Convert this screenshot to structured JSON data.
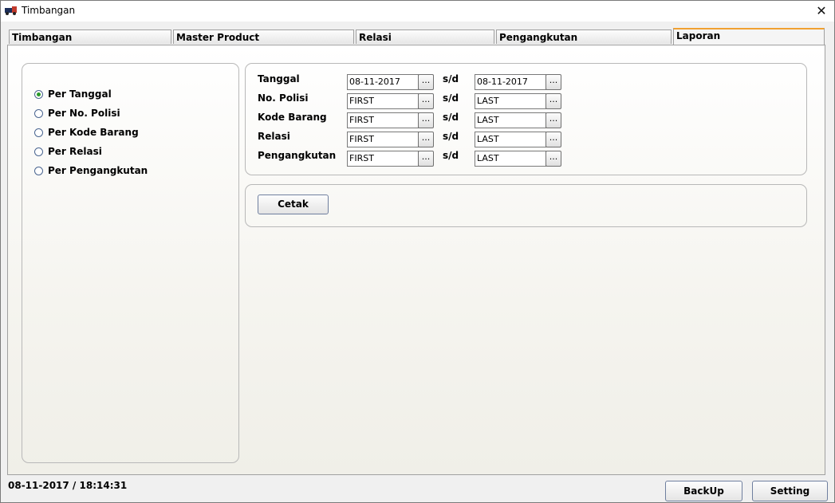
{
  "window": {
    "title": "Timbangan",
    "close_glyph": "✕"
  },
  "tabs": [
    {
      "label": "Timbangan"
    },
    {
      "label": "Master Product"
    },
    {
      "label": "Relasi"
    },
    {
      "label": "Pengangkutan"
    },
    {
      "label": "Laporan",
      "active": true
    }
  ],
  "report_options": [
    {
      "label": "Per Tanggal",
      "checked": true
    },
    {
      "label": "Per No. Polisi",
      "checked": false
    },
    {
      "label": "Per Kode Barang",
      "checked": false
    },
    {
      "label": "Per Relasi",
      "checked": false
    },
    {
      "label": "Per Pengangkutan",
      "checked": false
    }
  ],
  "filters": [
    {
      "label": "Tanggal",
      "from": "08-11-2017",
      "sd": "s/d",
      "to": "08-11-2017"
    },
    {
      "label": "No. Polisi",
      "from": "FIRST",
      "sd": "s/d",
      "to": "LAST"
    },
    {
      "label": "Kode Barang",
      "from": "FIRST",
      "sd": "s/d",
      "to": "LAST"
    },
    {
      "label": "Relasi",
      "from": "FIRST",
      "sd": "s/d",
      "to": "LAST"
    },
    {
      "label": "Pengangkutan",
      "from": "FIRST",
      "sd": "s/d",
      "to": "LAST"
    }
  ],
  "ellipsis": "...",
  "actions": {
    "print_label": "Cetak"
  },
  "statusbar": {
    "datetime": "08-11-2017 / 18:14:31",
    "backup_label": "BackUp",
    "setting_label": "Setting"
  },
  "colors": {
    "active_tab_accent": "#f0a030",
    "radio_dot": "#2a9a2a"
  }
}
